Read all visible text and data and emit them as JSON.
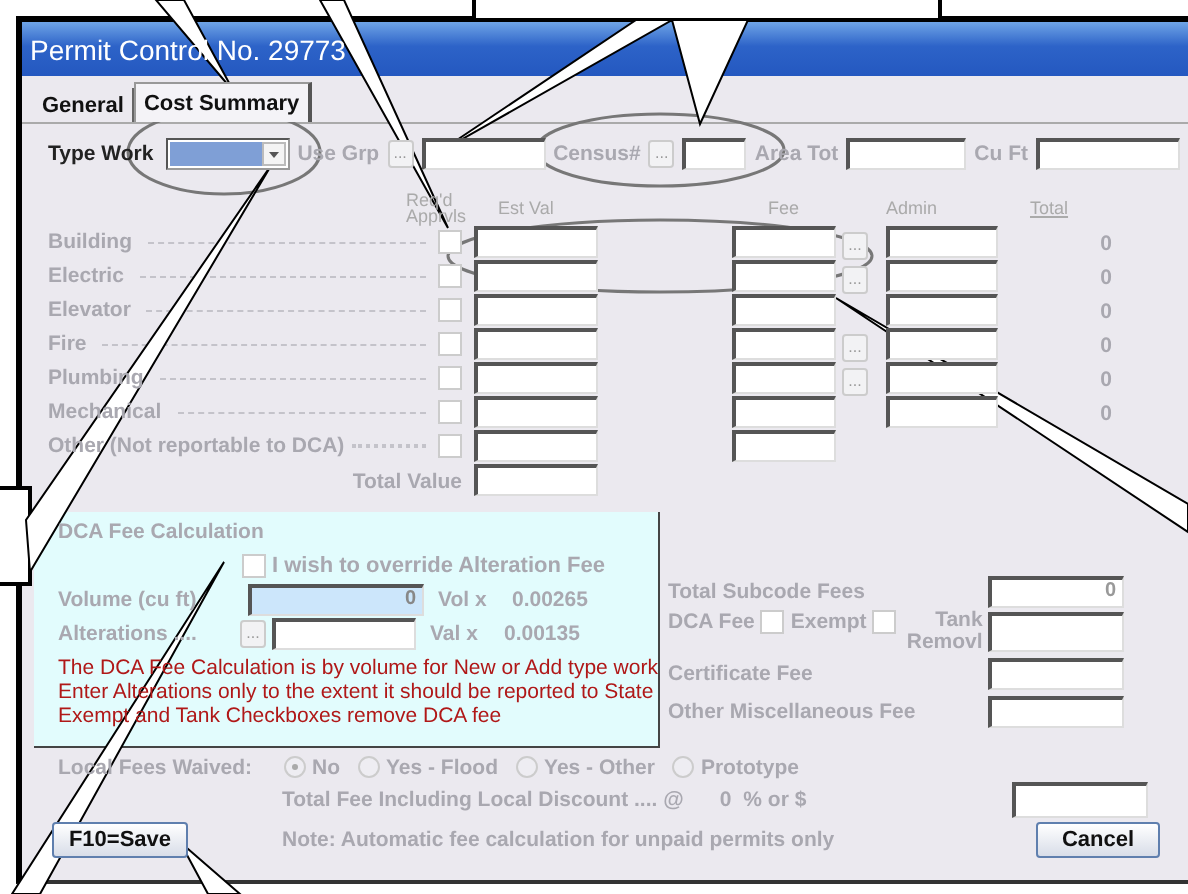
{
  "window": {
    "title": "Permit Control No. 29773"
  },
  "tabs": [
    {
      "label": "General",
      "selected": false
    },
    {
      "label": "Cost Summary",
      "selected": true
    }
  ],
  "header_fields": [
    {
      "label": "Type Work",
      "kind": "dropdown",
      "disabled": false
    },
    {
      "label": "Use Grp",
      "kind": "lookup",
      "button": "...",
      "disabled": true
    },
    {
      "label": "Census#",
      "kind": "lookup",
      "button": "...",
      "disabled": true
    },
    {
      "label": "Area Tot",
      "kind": "text",
      "disabled": true
    },
    {
      "label": "Cu Ft",
      "kind": "text",
      "disabled": true
    }
  ],
  "subcodes": {
    "columns": [
      "Req'd Apprvls",
      "Est Val",
      "Fee",
      "Admin",
      "Total"
    ],
    "rows": [
      {
        "name": "Building",
        "kind": "dashed",
        "approval": false,
        "fee_button": "...",
        "admin": true,
        "total": "0"
      },
      {
        "name": "Electric",
        "kind": "dashed",
        "approval": false,
        "fee_button": "...",
        "admin": true,
        "total": "0"
      },
      {
        "name": "Elevator",
        "kind": "dashed",
        "approval": false,
        "admin": true,
        "total": "0"
      },
      {
        "name": "Fire",
        "kind": "dashed",
        "approval": false,
        "fee_button": "...",
        "admin": true,
        "total": "0"
      },
      {
        "name": "Plumbing",
        "kind": "dashed",
        "approval": false,
        "fee_button": "...",
        "admin": true,
        "total": "0"
      },
      {
        "name": "Mechanical",
        "kind": "dashed",
        "approval": false,
        "admin": true,
        "total": "0"
      },
      {
        "name": "Other (Not reportable to DCA)",
        "kind": "dotted",
        "approval": false,
        "admin": false
      }
    ],
    "total_label": "Total Value"
  },
  "dca": {
    "title": "DCA Fee Calculation",
    "override": {
      "label": "I wish to override Alteration Fee",
      "checked": false
    },
    "volume": {
      "label": "Volume (cu ft)",
      "value": "0",
      "rate_label": "Vol x",
      "rate": "0.00265"
    },
    "alterations": {
      "label": "Alterations ....",
      "button": "...",
      "rate_label": "Val x",
      "rate": "0.00135"
    },
    "notes": [
      "The DCA Fee Calculation is by volume for New or Add type work",
      "Enter Alterations only to the extent it should be reported to State",
      "Exempt and Tank Checkboxes remove DCA fee"
    ]
  },
  "fees": [
    {
      "kind": "amount",
      "label": "Total Subcode Fees",
      "value": "0"
    },
    {
      "kind": "dca",
      "label": "DCA Fee",
      "exempt": {
        "label": "Exempt",
        "checked": false
      },
      "tank": {
        "label": "Tank Removl",
        "checked": false
      }
    },
    {
      "kind": "amount",
      "label": "Certificate Fee"
    },
    {
      "kind": "amount",
      "label": "Other Miscellaneous Fee"
    }
  ],
  "local_fees": {
    "label": "Local Fees Waived:",
    "options": [
      {
        "label": "No",
        "selected": true
      },
      {
        "label": "Yes - Flood",
        "selected": false
      },
      {
        "label": "Yes - Other",
        "selected": false
      },
      {
        "label": "Prototype",
        "selected": false
      }
    ]
  },
  "total_fee": {
    "label": "Total Fee Including Local Discount .... @",
    "discount": "0",
    "unit": "% or $"
  },
  "save_button": "F10=Save",
  "note": "Note:  Automatic fee calculation for unpaid permits only",
  "cancel_button": "Cancel"
}
